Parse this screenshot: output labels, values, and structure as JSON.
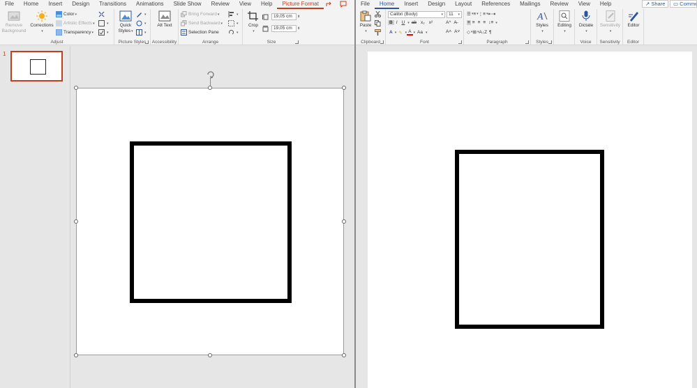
{
  "powerpoint": {
    "tabs": [
      "File",
      "Home",
      "Insert",
      "Design",
      "Transitions",
      "Animations",
      "Slide Show",
      "Review",
      "View",
      "Help",
      "Picture Format"
    ],
    "active_tab": "Picture Format",
    "ribbon": {
      "adjust": {
        "label": "Adjust",
        "remove_background": "Remove Background",
        "corrections": "Corrections",
        "color": "Color",
        "artistic_effects": "Artistic Effects",
        "transparency": "Transparency"
      },
      "picture_styles": {
        "label": "Picture Styles",
        "quick_styles": "Quick Styles"
      },
      "accessibility": {
        "label": "Accessibility",
        "alt_text": "Alt Text"
      },
      "arrange": {
        "label": "Arrange",
        "bring_forward": "Bring Forward",
        "send_backward": "Send Backward",
        "selection_pane": "Selection Pane"
      },
      "size": {
        "label": "Size",
        "crop": "Crop",
        "height": "19,05 cm",
        "width": "19,05 cm"
      }
    },
    "slide_number": "1"
  },
  "word": {
    "tabs": [
      "File",
      "Home",
      "Insert",
      "Design",
      "Layout",
      "References",
      "Mailings",
      "Review",
      "View",
      "Help"
    ],
    "active_tab": "Home",
    "share": "Share",
    "comments": "Comments",
    "ribbon": {
      "clipboard": {
        "label": "Clipboard",
        "paste": "Paste"
      },
      "font": {
        "label": "Font",
        "font_name": "Calibri (Body)",
        "font_size": "11"
      },
      "paragraph": {
        "label": "Paragraph"
      },
      "styles": {
        "label": "Styles",
        "styles_btn": "Styles"
      },
      "editing": {
        "editing_btn": "Editing"
      },
      "voice": {
        "label": "Voice",
        "dictate": "Dictate"
      },
      "sensitivity": {
        "label": "Sensitivity",
        "sensitivity_btn": "Sensitivity"
      },
      "editor": {
        "label": "Editor",
        "editor_btn": "Editor"
      }
    }
  },
  "colors": {
    "ppt_accent": "#c43e1c",
    "word_accent": "#2b579a"
  }
}
